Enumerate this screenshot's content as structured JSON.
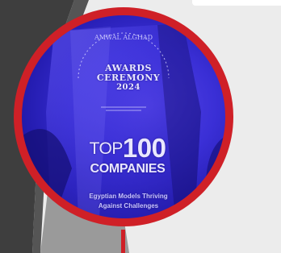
{
  "badge": {
    "arc_text": "AMWAL ALGHAD",
    "line1": "AWARDS",
    "line2": "CEREMONY",
    "year": "2024",
    "top_prefix": "TOP",
    "top_number": "100",
    "companies": "COMPANIES",
    "subtitle_line1": "Egyptian Models Thriving",
    "subtitle_line2": "Against Challenges"
  },
  "colors": {
    "ring": "#cf2027",
    "background": "#ececec",
    "dark_shape": "#3e3e3e",
    "glow": "#3a2fd6"
  }
}
